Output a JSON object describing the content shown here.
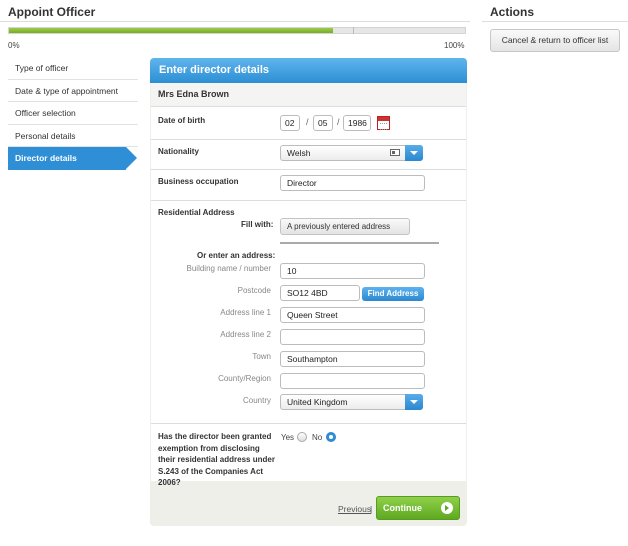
{
  "header": {
    "title": "Appoint Officer",
    "progress_start": "0%",
    "progress_end": "100%",
    "progress_fraction": 0.71
  },
  "sidebar": {
    "title": "Actions",
    "cancel_label": "Cancel & return to officer list"
  },
  "steps": [
    {
      "label": "Type of officer"
    },
    {
      "label": "Date & type of appointment"
    },
    {
      "label": "Officer selection"
    },
    {
      "label": "Personal details"
    },
    {
      "label": "Director details",
      "active": true
    }
  ],
  "form": {
    "title": "Enter director details",
    "person_name": "Mrs Edna Brown",
    "dob": {
      "label": "Date of birth",
      "day": "02",
      "month": "05",
      "year": "1986",
      "sep": "/"
    },
    "nationality": {
      "label": "Nationality",
      "value": "Welsh"
    },
    "occupation": {
      "label": "Business occupation",
      "value": "Director"
    },
    "address": {
      "section_label": "Residential Address",
      "fill_with_label": "Fill with:",
      "fill_button": "A previously entered address",
      "or_enter": "Or enter an address:",
      "building": {
        "label": "Building name / number",
        "value": "10"
      },
      "postcode": {
        "label": "Postcode",
        "value": "SO12 4BD",
        "find_label": "Find Address"
      },
      "line1": {
        "label": "Address line 1",
        "value": "Queen Street"
      },
      "line2": {
        "label": "Address line 2",
        "value": ""
      },
      "town": {
        "label": "Town",
        "value": "Southampton"
      },
      "county": {
        "label": "County/Region",
        "value": ""
      },
      "country": {
        "label": "Country",
        "value": "United Kingdom"
      }
    },
    "exemption": {
      "question": "Has the director been granted exemption from disclosing their residential address under S.243 of the Companies Act 2006?",
      "yes": "Yes",
      "no": "No",
      "selected": "No"
    },
    "previous_label": "Previous",
    "pipe": "|",
    "continue_label": "Continue"
  }
}
